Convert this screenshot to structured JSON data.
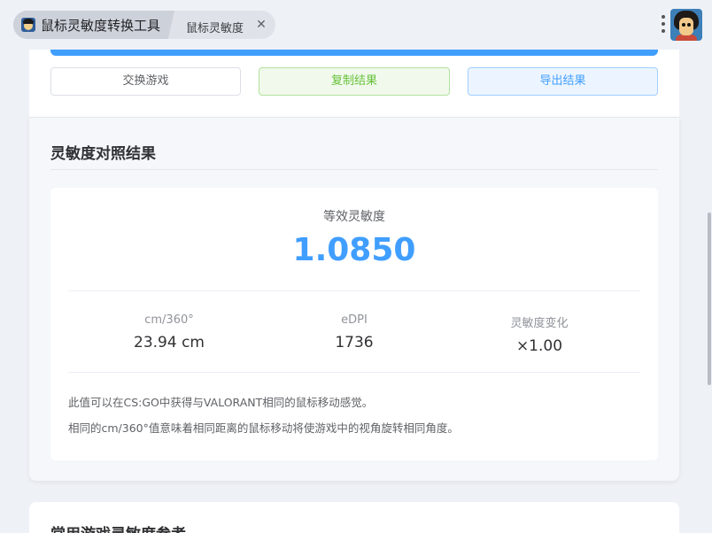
{
  "tab": {
    "app_title": "鼠标灵敏度转换工具",
    "page_title": "鼠标灵敏度",
    "close_glyph": "✕"
  },
  "actions": {
    "swap_label": "交换游戏",
    "copy_label": "复制结果",
    "export_label": "导出结果"
  },
  "result": {
    "section_title": "灵敏度对照结果",
    "equivalent_label": "等效灵敏度",
    "equivalent_value": "1.0850",
    "stats": [
      {
        "label": "cm/360°",
        "value": "23.94 cm"
      },
      {
        "label": "eDPI",
        "value": "1736"
      },
      {
        "label": "灵敏度变化",
        "value": "×1.00"
      }
    ],
    "notes": [
      "此值可以在CS:GO中获得与VALORANT相同的鼠标移动感觉。",
      "相同的cm/360°值意味着相同距离的鼠标移动将使游戏中的视角旋转相同角度。"
    ]
  },
  "next_section": {
    "title": "常用游戏灵敏度参考"
  },
  "icons": {
    "app": "app-avatar-icon",
    "close": "close-icon",
    "menu": "kebab-menu-icon",
    "profile": "profile-avatar"
  },
  "colors": {
    "primary": "#409eff",
    "success": "#67c23a",
    "text": "#303133",
    "muted": "#909399"
  }
}
